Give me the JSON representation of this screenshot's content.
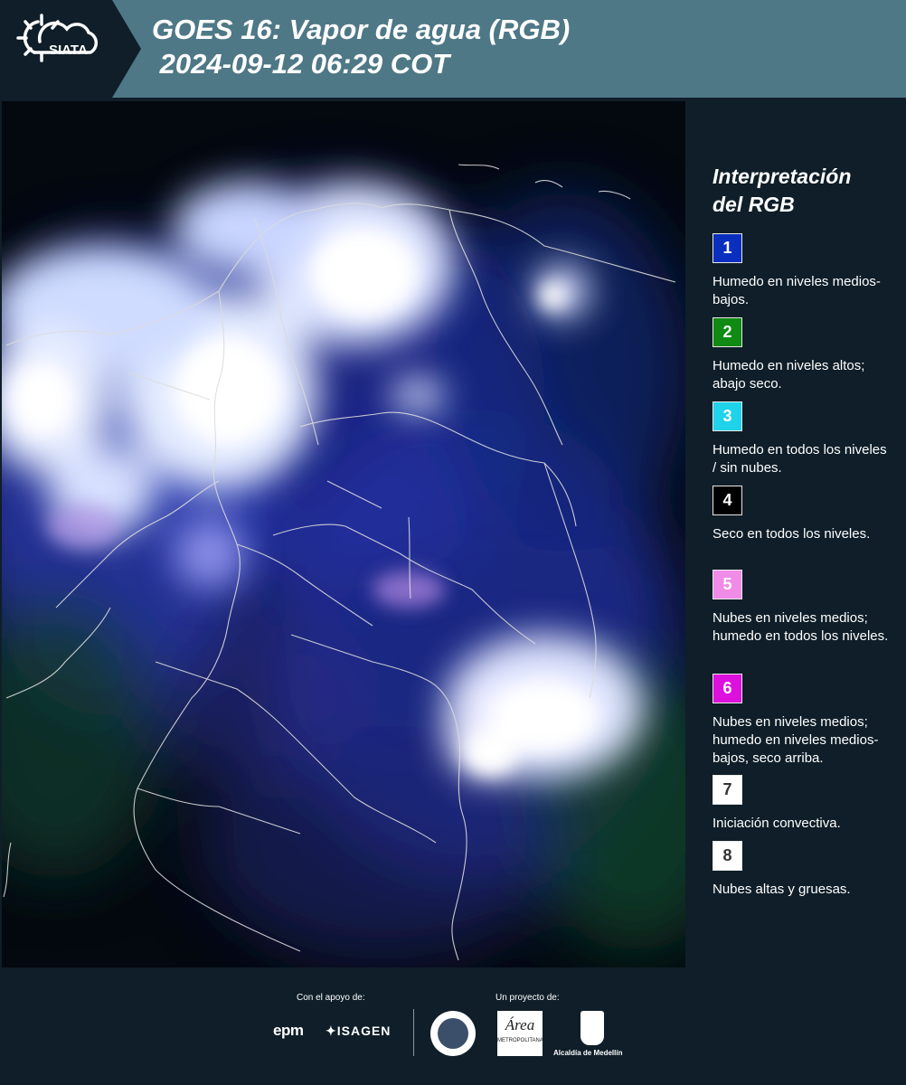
{
  "header": {
    "logo_text": "SIATA",
    "title": "GOES 16: Vapor de agua (RGB)\n 2024-09-12 06:29 COT"
  },
  "legend": {
    "title": "Interpretación\ndel RGB",
    "items": [
      {
        "number": "1",
        "color": "#0a2fbf",
        "description": "Humedo en niveles medios-bajos."
      },
      {
        "number": "2",
        "color": "#0f8a12",
        "description": "Humedo en niveles altos; abajo seco."
      },
      {
        "number": "3",
        "color": "#1ed3ea",
        "description": "Humedo en todos los niveles / sin nubes."
      },
      {
        "number": "4",
        "color": "#000000",
        "description": "Seco en todos los niveles."
      },
      {
        "number": "5",
        "color": "#f08ce8",
        "description": "Nubes en niveles medios; humedo en todos los niveles."
      },
      {
        "number": "6",
        "color": "#de10de",
        "description": "Nubes en niveles medios; humedo en niveles medios-bajos, seco arriba."
      },
      {
        "number": "7",
        "color": "#ffffff",
        "description": "Iniciación convectiva."
      },
      {
        "number": "8",
        "color": "#ffffff",
        "description": "Nubes altas y gruesas."
      }
    ]
  },
  "footer": {
    "support_label": "Con el apoyo de:",
    "project_label": "Un proyecto de:",
    "logos": {
      "epm": "epm",
      "isagen": "ISAGEN",
      "area_metropolitana": "Área",
      "area_metropolitana_sub": "METROPOLITANA",
      "alcaldia": "Alcaldía de Medellín"
    }
  }
}
